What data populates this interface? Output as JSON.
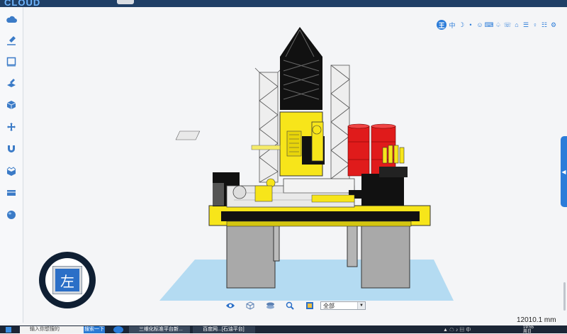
{
  "app": {
    "logo_text": "CLOUD"
  },
  "left_toolbar": [
    {
      "name": "cloud-icon"
    },
    {
      "name": "brush-icon"
    },
    {
      "name": "rectangle-icon"
    },
    {
      "name": "layers-edit-icon"
    },
    {
      "name": "cube-icon"
    },
    {
      "name": "move-icon"
    },
    {
      "name": "magnet-icon"
    },
    {
      "name": "box-open-icon"
    },
    {
      "name": "panel-icon"
    },
    {
      "name": "sphere-icon"
    }
  ],
  "top_icons": [
    "王",
    "中",
    "☽",
    "•",
    "☺",
    "⌨",
    "♤",
    "☏",
    "⌂",
    "☰",
    "♀",
    "☷",
    "⚙"
  ],
  "nav_cube": {
    "face_label": "左"
  },
  "bottom_toolbar": {
    "filter_value": "全部"
  },
  "scale": {
    "text": "12010.1 mm"
  },
  "taskbar": {
    "search_placeholder": "输入你想搜的",
    "search_button": "搜索一下",
    "apps": [
      "三维化标准平台新...",
      "百度网...[石油平台]"
    ],
    "tray_text": "中",
    "clock_time": "19:55",
    "clock_day": "周日"
  },
  "colors": {
    "accent": "#2b7cd9",
    "taskbar": "#1b2636",
    "rig_yellow": "#f7e51a",
    "barrel_red": "#e01b1b",
    "floor_blue": "#9fd0ef"
  }
}
